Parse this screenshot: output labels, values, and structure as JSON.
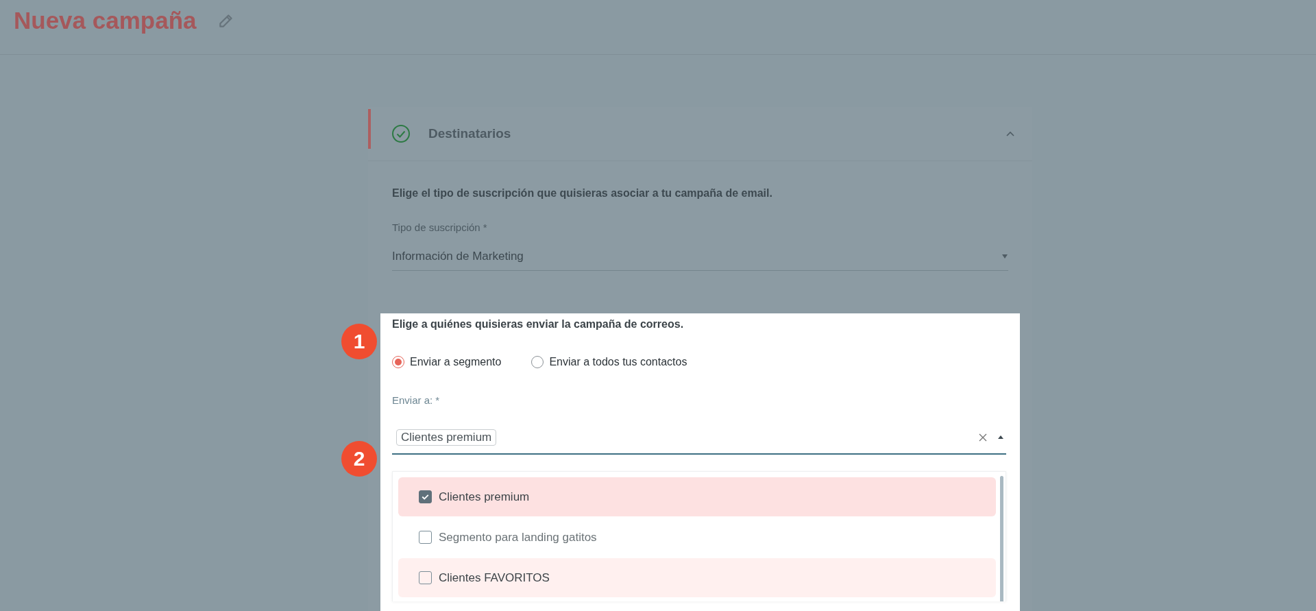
{
  "page": {
    "title": "Nueva campaña"
  },
  "section": {
    "title": "Destinatarios",
    "completed": true,
    "expanded": true
  },
  "subscription": {
    "prompt": "Elige el tipo de suscripción que quisieras asociar a tu campaña de email.",
    "label": "Tipo de suscripción *",
    "value": "Información de Marketing"
  },
  "recipients": {
    "prompt": "Elige a quiénes quisieras enviar la campaña de correos.",
    "options": [
      {
        "label": "Enviar a segmento",
        "selected": true
      },
      {
        "label": "Enviar a todos tus contactos",
        "selected": false
      }
    ],
    "label": "Enviar a: *",
    "chips": [
      "Clientes premium"
    ],
    "expanded": true,
    "items": [
      {
        "label": "Clientes premium",
        "checked": true,
        "hovered": false
      },
      {
        "label": "Segmento para landing gatitos",
        "checked": false,
        "hovered": false
      },
      {
        "label": "Clientes FAVORITOS",
        "checked": false,
        "hovered": true
      }
    ]
  },
  "callouts": [
    "1",
    "2"
  ]
}
